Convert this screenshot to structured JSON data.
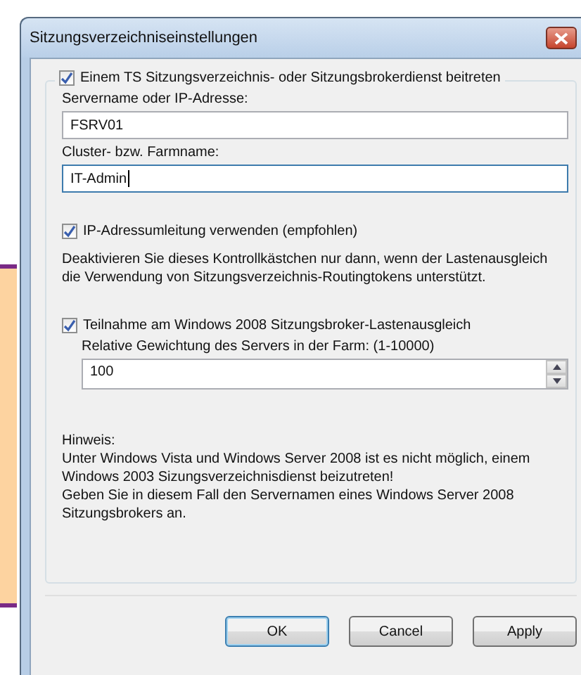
{
  "window": {
    "title": "Sitzungsverzeichniseinstellungen"
  },
  "join_checkbox": {
    "label": "Einem TS Sitzungsverzeichnis- oder Sitzungsbrokerdienst beitreten",
    "checked": true
  },
  "fields": [
    {
      "label": "Servername oder IP-Adresse:",
      "value": "FSRV01",
      "focused": false
    },
    {
      "label": "Cluster- bzw. Farmname:",
      "value": "IT-Admin",
      "focused": true
    }
  ],
  "ip_redirect_checkbox": {
    "label": "IP-Adressumleitung verwenden (empfohlen)",
    "checked": true
  },
  "ip_redirect_note": "Deaktivieren Sie dieses Kontrollkästchen nur dann, wenn der Lastenausgleich die Verwendung von Sitzungsverzeichnis-Routingtokens unterstützt.",
  "load_balancing_checkbox": {
    "label": "Teilnahme am Windows 2008 Sitzungsbroker-Lastenausgleich",
    "checked": true
  },
  "weight": {
    "label": "Relative Gewichtung des Servers in der Farm: (1-10000)",
    "value": "100"
  },
  "hint": [
    "Hinweis:",
    "Unter Windows Vista und Windows Server 2008 ist es nicht möglich, einem Windows 2003 Sizungsverzeichnisdienst beizutreten!",
    "Geben Sie in diesem Fall den Servernamen eines Windows Server 2008 Sitzungsbrokers an."
  ],
  "buttons": [
    {
      "label": "OK",
      "default": true
    },
    {
      "label": "Cancel",
      "default": false
    },
    {
      "label": "Apply",
      "default": false
    }
  ]
}
